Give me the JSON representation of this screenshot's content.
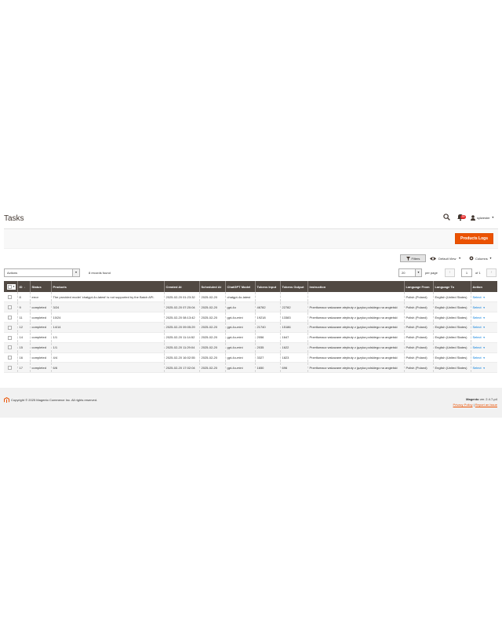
{
  "page": {
    "title": "Tasks"
  },
  "header": {
    "notifications_count": "39",
    "username": "sylwester"
  },
  "actionbar": {
    "primary_button": "Products Logs"
  },
  "toolbar": {
    "filters_label": "Filters",
    "view_label": "Default View",
    "columns_label": "Columns",
    "actions_value": "Actions",
    "records_found": "8 records found",
    "per_page_value": "20",
    "per_page_label": "per page",
    "current_page": "1",
    "page_of": "of 1"
  },
  "grid": {
    "columns": [
      "ID",
      "Status",
      "Products",
      "Created At",
      "Scheduled At",
      "ChatGPT Model",
      "Tokens Input",
      "Tokens Output",
      "Instruction",
      "Language From",
      "Language To",
      "Action"
    ],
    "rows": [
      {
        "id": "8",
        "status": "error",
        "products": "The provided model 'chatgpt-4o-latest' is not supported by the Batch API.",
        "created": "2025-02-20 01:23:32",
        "scheduled": "2025-02-20",
        "model": "chatgpt-4o-latest",
        "tin": "",
        "tout": "",
        "instruction": "",
        "lang_from": "Polish (Poland)",
        "lang_to": "English (United States)",
        "action": "Select"
      },
      {
        "id": "9",
        "status": "completed",
        "products": "3/24",
        "created": "2025-02-20 07:20:04",
        "scheduled": "2025-02-20",
        "model": "gpt-4o",
        "tin": "46782",
        "tout": "22782",
        "instruction": "Przetłumacz wskazane atrybuty z języka polskiego na angielski",
        "lang_from": "Polish (Poland)",
        "lang_to": "English (United States)",
        "action": "Select"
      },
      {
        "id": "11",
        "status": "completed",
        "products": "10/24",
        "created": "2025-02-20 08:13:42",
        "scheduled": "2025-02-20",
        "model": "gpt-4o-mini",
        "tin": "19218",
        "tout": "13383",
        "instruction": "Przetłumacz wskazane atrybuty z języka polskiego na angielski",
        "lang_from": "Polish (Poland)",
        "lang_to": "English (United States)",
        "action": "Select"
      },
      {
        "id": "12",
        "status": "completed",
        "products": "14/14",
        "created": "2025-02-20 09:05:29",
        "scheduled": "2025-02-20",
        "model": "gpt-4o-mini",
        "tin": "21740",
        "tout": "15186",
        "instruction": "Przetłumacz wskazane atrybuty z języka polskiego na angielski",
        "lang_from": "Polish (Poland)",
        "lang_to": "English (United States)",
        "action": "Select"
      },
      {
        "id": "14",
        "status": "completed",
        "products": "1/1",
        "created": "2025-02-20 11:14:52",
        "scheduled": "2025-02-20",
        "model": "gpt-4o-mini",
        "tin": "2056",
        "tout": "1647",
        "instruction": "Przetłumacz wskazane atrybuty z języka polskiego na angielski",
        "lang_from": "Polish (Poland)",
        "lang_to": "English (United States)",
        "action": "Select"
      },
      {
        "id": "15",
        "status": "completed",
        "products": "1/1",
        "created": "2025-02-20 11:29:04",
        "scheduled": "2025-02-20",
        "model": "gpt-4o-mini",
        "tin": "2035",
        "tout": "1622",
        "instruction": "Przetłumacz wskazane atrybuty z języka polskiego na angielski",
        "lang_from": "Polish (Poland)",
        "lang_to": "English (United States)",
        "action": "Select"
      },
      {
        "id": "16",
        "status": "completed",
        "products": "4/4",
        "created": "2025-02-20 16:02:55",
        "scheduled": "2025-02-20",
        "model": "gpt-4o-mini",
        "tin": "3327",
        "tout": "1823",
        "instruction": "Przetłumacz wskazane atrybuty z języka polskiego na angielski",
        "lang_from": "Polish (Poland)",
        "lang_to": "English (United States)",
        "action": "Select"
      },
      {
        "id": "17",
        "status": "completed",
        "products": "6/6",
        "created": "2025-02-20 17:02:04",
        "scheduled": "2025-02-20",
        "model": "gpt-4o-mini",
        "tin": "1650",
        "tout": "696",
        "instruction": "Przetłumacz wskazane atrybuty z języka polskiego na angielski",
        "lang_from": "Polish (Poland)",
        "lang_to": "English (United States)",
        "action": "Select"
      }
    ]
  },
  "footer": {
    "copyright": "Copyright © 2025 Magento Commerce Inc. All rights reserved.",
    "brand": "Magento",
    "version": "ver. 2.4.7-p4",
    "privacy_link": "Privacy Policy",
    "separator": "|",
    "report_link": "Report an Issue"
  },
  "colors": {
    "accent": "#eb5202",
    "header_bg": "#514943",
    "link": "#007bdb"
  },
  "icons": {
    "search": "search-icon",
    "notifications": "bell-icon",
    "user": "user-icon",
    "filters": "funnel-icon",
    "view": "eye-icon",
    "columns": "gear-icon",
    "logo": "magento-logo-icon"
  }
}
